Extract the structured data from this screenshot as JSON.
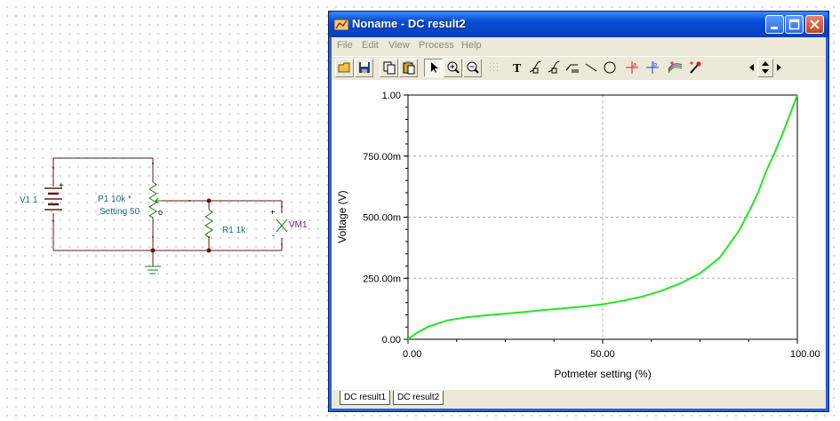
{
  "schematic": {
    "v1_label": "V1 1",
    "p1_label": "P1 10k *",
    "p1_setting": "Setting 50",
    "r1_label": "R1 1k",
    "vm1_label": "VM1",
    "plus_sign": "+",
    "minus_sign": "-",
    "wiper_mark": "o"
  },
  "window": {
    "title": "Noname - DC result2",
    "menu": [
      "File",
      "Edit",
      "View",
      "Process",
      "Help"
    ],
    "toolbar_icons": [
      "open-icon",
      "save-icon",
      "copy-icon",
      "paste-icon",
      "select-arrow-icon",
      "zoom-in-icon",
      "zoom-out-icon",
      "grid-icon",
      "text-icon",
      "marker-a-icon",
      "marker-b-icon",
      "curve-label-icon",
      "line-icon",
      "circle-icon",
      "cursor-a-icon",
      "cursor-b-icon",
      "curve-color-icon",
      "probe-icon",
      "arrow-left-icon",
      "arrow-up-down-icon",
      "arrow-right-icon"
    ],
    "tabs": [
      "DC result1",
      "DC result2"
    ],
    "active_tab": "DC result2"
  },
  "chart_data": {
    "type": "line",
    "xlabel": "Potmeter setting (%)",
    "ylabel": "Voltage (V)",
    "xlim": [
      0,
      100
    ],
    "ylim": [
      0,
      1
    ],
    "x_ticks": [
      "0.00",
      "50.00",
      "100.00"
    ],
    "y_ticks": [
      "0.00",
      "250.00m",
      "500.00m",
      "750.00m",
      "1.00"
    ],
    "grid": true,
    "series": [
      {
        "color": "#22e622",
        "x": [
          0,
          2,
          5,
          10,
          15,
          20,
          25,
          30,
          35,
          40,
          45,
          50,
          55,
          60,
          65,
          70,
          75,
          80,
          85,
          88,
          90,
          92,
          94,
          96,
          98,
          100
        ],
        "y": [
          0,
          0.024,
          0.05,
          0.077,
          0.09,
          0.098,
          0.105,
          0.112,
          0.12,
          0.127,
          0.134,
          0.143,
          0.157,
          0.174,
          0.198,
          0.229,
          0.27,
          0.333,
          0.444,
          0.536,
          0.604,
          0.688,
          0.757,
          0.833,
          0.916,
          1.0
        ]
      }
    ]
  }
}
